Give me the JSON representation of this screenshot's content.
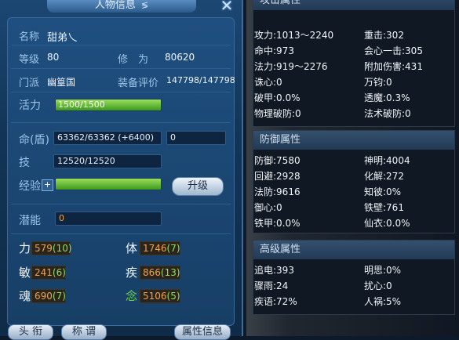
{
  "window": {
    "title": "人物信息",
    "title_icon": "≶",
    "close": "✕"
  },
  "info": {
    "name_label": "名称",
    "name": "甜弟乀",
    "level_label": "等级",
    "level": "80",
    "cultivation_label": "修　为",
    "cultivation": "80620",
    "faction_label": "门派",
    "faction": "幽篁国",
    "equip_label": "装备评价",
    "equip": "147798/147798"
  },
  "bars": {
    "vitality_label": "活力",
    "vitality": "1500/1500",
    "life_label": "命(盾)",
    "life": "63362/63362 (+6400)",
    "shield": "0",
    "skill_label": "技",
    "skill": "12520/12520",
    "exp_label": "经验",
    "exp_plus": "+",
    "upgrade": "升级",
    "potential_label": "潜能",
    "potential": "0"
  },
  "stats": [
    {
      "label": "力",
      "base": "579",
      "bonus": "(10)"
    },
    {
      "label": "体",
      "base": "1746",
      "bonus": "(7)"
    },
    {
      "label": "敏",
      "base": "241",
      "bonus": "(6)"
    },
    {
      "label": "疾",
      "base": "866",
      "bonus": "(13)"
    },
    {
      "label": "魂",
      "base": "690",
      "bonus": "(7)"
    },
    {
      "label": "念",
      "base": "5106",
      "bonus": "(5)"
    }
  ],
  "bottom_buttons": [
    "头 衔",
    "称 谓",
    "属性信息"
  ],
  "right": {
    "top_title": "攻击属性",
    "attack": [
      [
        "攻力:1013～2240",
        "重击:302"
      ],
      [
        "命中:973",
        "会心一击:305"
      ],
      [
        "法力:919～2276",
        "附加伤害:431"
      ],
      [
        "诛心:0",
        "万钧:0"
      ],
      [
        "破甲:0.0%",
        "透魔:0.3%"
      ],
      [
        "物理破防:0",
        "法术破防:0"
      ]
    ],
    "defense_title": "防御属性",
    "defense": [
      [
        "防御:7580",
        "神明:4004"
      ],
      [
        "回避:2928",
        "化解:272"
      ],
      [
        "法防:9616",
        "知彼:0%"
      ],
      [
        "御心:0",
        "铁壁:761"
      ],
      [
        "铁甲:0.0%",
        "仙衣:0.0%"
      ]
    ],
    "advanced_title": "高级属性",
    "advanced": [
      [
        "追电:393",
        "明思:0%"
      ],
      [
        "骤雨:24",
        "扰心:0"
      ],
      [
        "疾语:72%",
        "人祸:5%"
      ]
    ]
  }
}
